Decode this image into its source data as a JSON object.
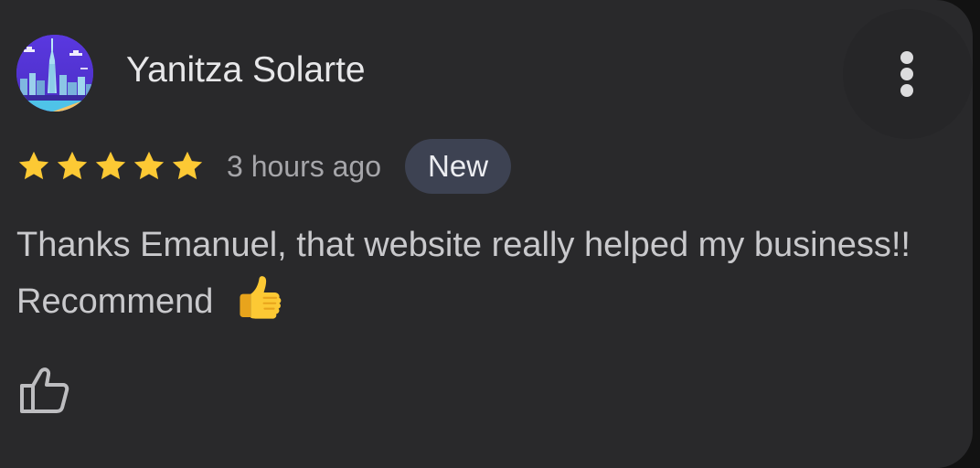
{
  "review": {
    "author_name": "Yanitza Solarte",
    "avatar_icon": "city-skyline-avatar",
    "rating": 5,
    "rating_max": 5,
    "time_ago": "3 hours ago",
    "badge": "New",
    "text": "Thanks Emanuel, that website really helped my business!! Recommend",
    "text_emoji": "thumbs-up-emoji",
    "actions": {
      "more_icon": "more-vert-icon",
      "like_icon": "thumb-up-outline-icon"
    }
  },
  "colors": {
    "card_background": "#29292b",
    "star": "#fcc934",
    "badge_background": "#3d4252",
    "text_primary": "#e7e7e9",
    "text_secondary": "#a6a6aa"
  }
}
